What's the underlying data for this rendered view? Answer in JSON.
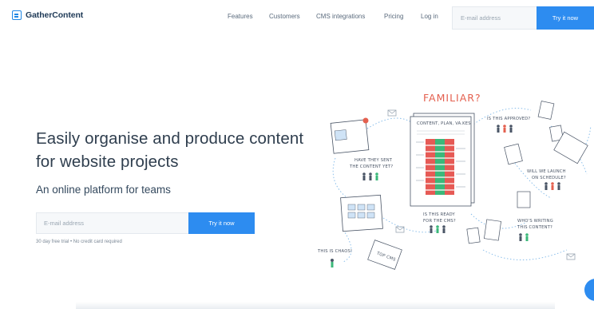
{
  "brand": {
    "name": "GatherContent",
    "logo_icon": "gathercontent-logo-icon"
  },
  "nav": {
    "links": [
      "Features",
      "Customers",
      "CMS integrations",
      "Pricing",
      "Log in"
    ],
    "email_placeholder": "E-mail address",
    "cta_label": "Try it now"
  },
  "hero": {
    "title": "Easily organise and produce content for website projects",
    "subtitle": "An online platform for teams",
    "email_placeholder": "E-mail address",
    "cta_label": "Try it now",
    "note": "30 day free trial  •  No credit card required"
  },
  "illustration": {
    "headline": "FAMILIAR?",
    "doc_title": "CONTENT, PLAN, VA.KES",
    "notes": {
      "approved": "IS THIS APPROVED?",
      "sent_1": "HAVE THEY SENT",
      "sent_2": "THE CONTENT YET?",
      "launch_1": "WILL WE LAUNCH",
      "launch_2": "ON SCHEDULE?",
      "ready_1": "IS THIS READY",
      "ready_2": "FOR THE CMS?",
      "writing_1": "WHO'S WRITING",
      "writing_2": "THIS CONTENT?",
      "chaos": "THIS IS CHAOS!",
      "card": "TOP CMS"
    }
  },
  "colors": {
    "accent": "#2d8cf0",
    "headline": "#e4604f",
    "text": "#2f3e4e"
  }
}
